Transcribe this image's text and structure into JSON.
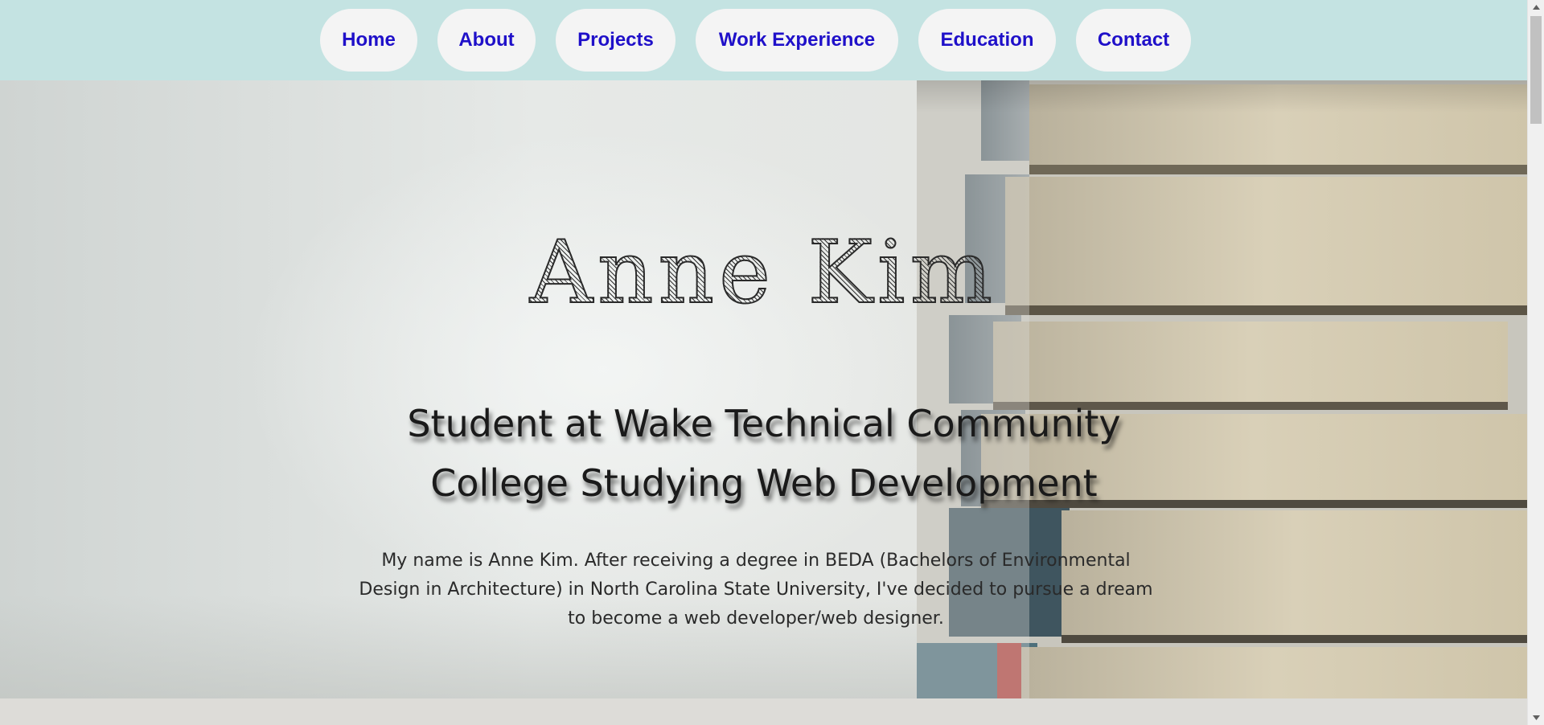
{
  "nav": {
    "items": [
      {
        "label": "Home"
      },
      {
        "label": "About"
      },
      {
        "label": "Projects"
      },
      {
        "label": "Work Experience"
      },
      {
        "label": "Education"
      },
      {
        "label": "Contact"
      }
    ],
    "link_color": "#1f10c9",
    "bar_color": "#c4e3e2",
    "pill_color": "#f4f4f4"
  },
  "hero": {
    "name": "Anne Kim",
    "heading": "Student at Wake Technical Community College Studying Web Development",
    "intro": "My name is Anne Kim. After receiving a degree in BEDA (Bachelors of Environmental Design in Architecture) in North Carolina State University, I've decided to pursue a dream to become a web developer/web designer.",
    "background_image": "stack-of-books-photo"
  },
  "scrollbar": {
    "up_icon": "arrow-up-icon",
    "down_icon": "arrow-down-icon"
  }
}
